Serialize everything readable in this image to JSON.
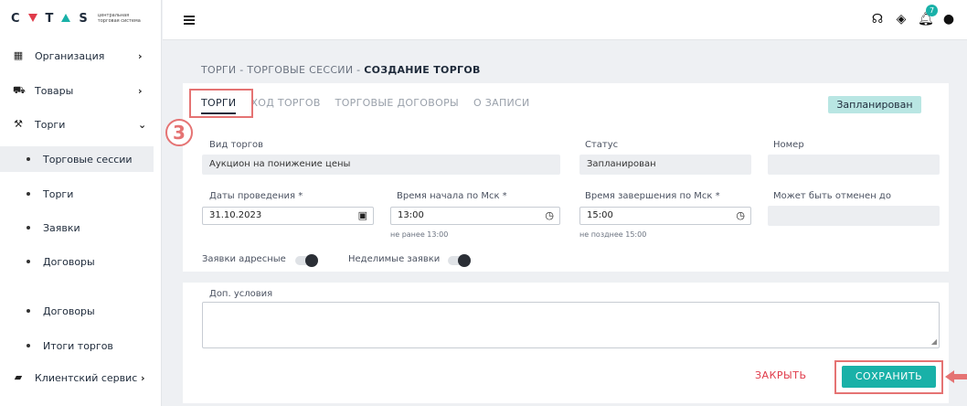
{
  "logo": {
    "letters": [
      "C",
      "T",
      "S"
    ],
    "subtitle": "центральная торговая система"
  },
  "sidebar": {
    "items": [
      {
        "label": "Организация",
        "icon": "building-icon",
        "has_chevron": true
      },
      {
        "label": "Товары",
        "icon": "cart-icon",
        "has_chevron": true
      },
      {
        "label": "Торги",
        "icon": "gavel-icon",
        "has_chevron": true,
        "expanded": true
      }
    ],
    "sub_items": [
      {
        "label": "Торговые сессии",
        "active": true
      },
      {
        "label": "Торги"
      },
      {
        "label": "Заявки"
      },
      {
        "label": "Договоры"
      },
      {
        "label": "Договоры"
      },
      {
        "label": "Итоги торгов"
      }
    ],
    "client_service": {
      "label": "Клиентский сервис",
      "icon": "chat-icon"
    }
  },
  "topbar": {
    "notification_count": "7"
  },
  "breadcrumb": {
    "part1": "ТОРГИ",
    "sep": " - ",
    "part2": "ТОРГОВЫЕ СЕССИИ",
    "current": "СОЗДАНИЕ ТОРГОВ"
  },
  "tabs": [
    {
      "label": "ТОРГИ",
      "active": true
    },
    {
      "label": "ХОД ТОРГОВ"
    },
    {
      "label": "ТОРГОВЫЕ ДОГОВОРЫ"
    },
    {
      "label": "О ЗАПИСИ"
    }
  ],
  "status_chip": "Запланирован",
  "step_marker": "3",
  "form": {
    "trade_type_label": "Вид торгов",
    "trade_type_value": "Аукцион на понижение цены",
    "status_label": "Статус",
    "status_value": "Запланирован",
    "number_label": "Номер",
    "number_value": "",
    "dates_label": "Даты проведения *",
    "dates_value": "31.10.2023",
    "start_time_label": "Время начала по Мск *",
    "start_time_value": "13:00",
    "start_time_hint": "не ранее 13:00",
    "end_time_label": "Время завершения по Мск *",
    "end_time_value": "15:00",
    "end_time_hint": "не позднее 15:00",
    "cancel_until_label": "Может быть отменен до",
    "cancel_until_value": "",
    "addressed_label": "Заявки адресные",
    "indivisible_label": "Неделимые заявки",
    "extra_label": "Доп. условия",
    "extra_value": ""
  },
  "actions": {
    "close": "ЗАКРЫТЬ",
    "save": "СОХРАНИТЬ"
  },
  "colors": {
    "accent": "#19b1a8",
    "danger": "#e03b4a",
    "highlight": "#e57373"
  }
}
